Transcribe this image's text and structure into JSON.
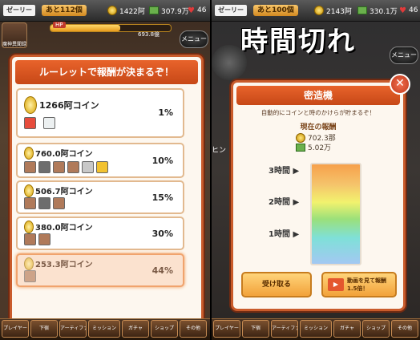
{
  "left": {
    "topbar": {
      "player_title": "ゼーリー",
      "player_sub": "無料で遊ぶ",
      "rank": "あと112個",
      "coins": "1422阿",
      "bills": "307.9万",
      "hearts": "46"
    },
    "xp": {
      "label": "HP",
      "value": "693.8億",
      "fill": 0.58
    },
    "side_icon": "魔神異聞録",
    "menu_label": "メニュー",
    "modal": {
      "title": "ルーレットで報酬が決まるぞ！",
      "rows": [
        {
          "label": "1266阿コイン",
          "pct": "1%"
        },
        {
          "label": "760.0阿コイン",
          "pct": "10%"
        },
        {
          "label": "506.7阿コイン",
          "pct": "15%"
        },
        {
          "label": "380.0阿コイン",
          "pct": "30%"
        },
        {
          "label": "253.3阿コイン",
          "pct": "44%"
        }
      ],
      "row1_gem_counts": [
        "5",
        "10"
      ]
    },
    "bottom_nav": [
      "プレイヤー",
      "下宿",
      "アーティファクト",
      "ミッション",
      "ガチャ",
      "ショップ",
      "その他"
    ]
  },
  "right": {
    "topbar": {
      "player_title": "ゼーリー",
      "player_sub": "無料で遊ぶ",
      "rank": "あと100個",
      "coins": "2143阿",
      "bills": "330.1万",
      "hearts": "46"
    },
    "big_title": "時間切れ",
    "menu_label": "メニュー",
    "side_label": "ヒン",
    "modal": {
      "title": "密造機",
      "description": "自動的にコインと時のかけらが貯まるぞ！",
      "current_label": "現在の報酬",
      "current_coins": "702.3那",
      "current_bills": "5.02万",
      "ticks": [
        "3時間",
        "2時間",
        "1時間"
      ],
      "gauge_fill": 1.0,
      "receive_button": "受け取る",
      "video_button": "動画を見て報酬1.5倍！",
      "close": "✕"
    },
    "bottom_nav": [
      "プレイヤー",
      "下宿",
      "アーティファクト",
      "ミッション",
      "ガチャ",
      "ショップ",
      "その他"
    ]
  },
  "colors": {
    "accent": "#e8632b",
    "modal_bg": "#fdf7ef",
    "highlight": "#fbe2cf"
  }
}
